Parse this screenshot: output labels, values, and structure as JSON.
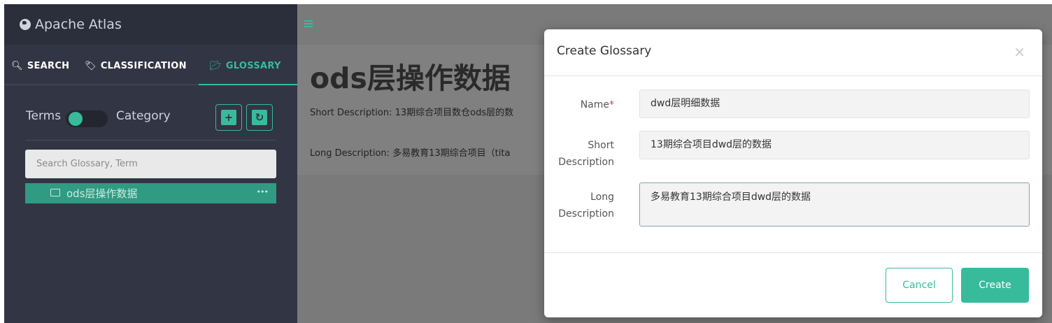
{
  "brand": {
    "title": "Apache Atlas",
    "icon": "globe-icon"
  },
  "tabs": [
    {
      "label": "SEARCH",
      "icon": "search-icon"
    },
    {
      "label": "CLASSIFICATION",
      "icon": "tag-icon"
    },
    {
      "label": "GLOSSARY",
      "icon": "folder-open-icon",
      "active": true
    }
  ],
  "toggle": {
    "left_label": "Terms",
    "right_label": "Category"
  },
  "sidebar_buttons": {
    "add": "+",
    "refresh": "↻"
  },
  "search": {
    "placeholder": "Search Glossary, Term"
  },
  "tree": {
    "items": [
      {
        "label": "ods层操作数据",
        "more": "•••"
      }
    ]
  },
  "main": {
    "title": "ods层操作数据",
    "short_description": "Short Description: 13期综合项目数仓ods层的数",
    "long_description": "Long Description: 多易教育13期综合项目（tita"
  },
  "modal": {
    "title": "Create Glossary",
    "close": "×",
    "fields": {
      "name": {
        "label": "Name",
        "required_mark": "*",
        "value": "dwd层明细数据"
      },
      "short": {
        "label_line1": "Short",
        "label_line2": "Description",
        "value": "13期综合项目dwd层的数据"
      },
      "long": {
        "label_line1": "Long",
        "label_line2": "Description",
        "value": "多易教育13期综合项目dwd层的数据"
      }
    },
    "buttons": {
      "cancel": "Cancel",
      "create": "Create"
    }
  },
  "colors": {
    "accent": "#37bb9b",
    "sidebar_bg": "#323544",
    "overlay": "#7a7a7a"
  }
}
